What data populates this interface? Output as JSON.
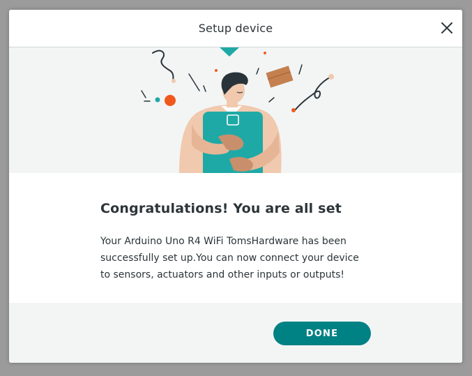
{
  "dialog": {
    "title": "Setup device",
    "close_icon": "close-icon"
  },
  "illustration": {
    "subject": "person-holding-device-illustration",
    "colors": {
      "teal": "#1fa9a6",
      "orange": "#f0591c",
      "skin": "#f0c9ae",
      "box": "#c4814f",
      "hair": "#28343a"
    }
  },
  "content": {
    "title": "Congratulations! You are all set",
    "message": "Your Arduino Uno R4 WiFi TomsHardware has been successfully set up.You can now connect your device to sensors, actuators and other inputs or outputs!"
  },
  "footer": {
    "done_label": "DONE"
  },
  "colors": {
    "accent": "#008184",
    "panel_bg": "#f3f5f5",
    "text": "#2c3438"
  }
}
